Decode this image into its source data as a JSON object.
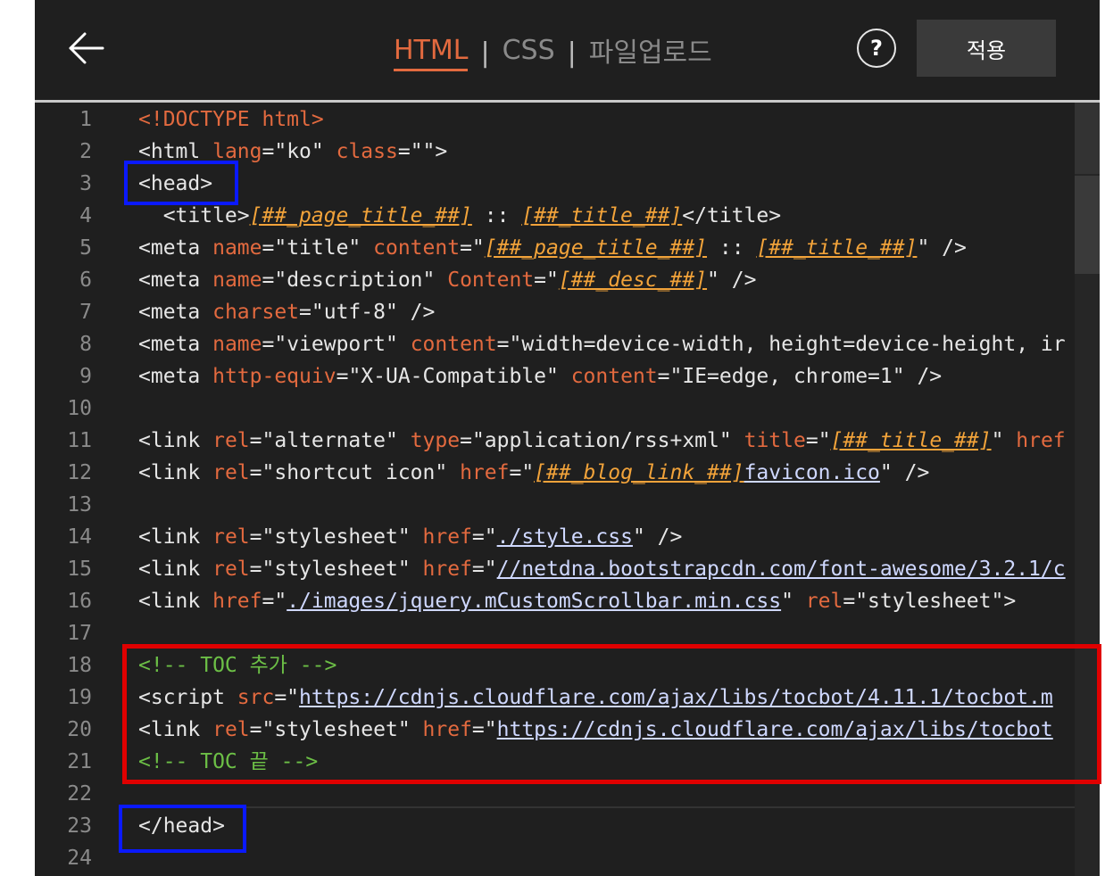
{
  "header": {
    "tabs": [
      {
        "label": "HTML",
        "active": true
      },
      {
        "label": "CSS",
        "active": false
      },
      {
        "label": "파일업로드",
        "active": false
      }
    ],
    "separator": "|",
    "help_label": "?",
    "apply_label": "적용",
    "back_icon": "back-arrow-icon",
    "help_icon": "question-circle-icon"
  },
  "colors": {
    "background": "#1f1f1f",
    "accent": "#e36a3f",
    "template_var": "#f2a33a",
    "comment": "#6cbf46",
    "highlight_blue": "#0a19ff",
    "highlight_red": "#e00000"
  },
  "code": {
    "lines": [
      {
        "n": "1",
        "segs": [
          [
            "dt",
            "<!DOCTYPE html>"
          ]
        ]
      },
      {
        "n": "2",
        "segs": [
          [
            "t",
            "<html "
          ],
          [
            "at",
            "lang"
          ],
          [
            "t",
            "="
          ],
          [
            "s",
            "\"ko\""
          ],
          [
            "t",
            " "
          ],
          [
            "at",
            "class"
          ],
          [
            "t",
            "="
          ],
          [
            "s",
            "\"\""
          ],
          [
            "t",
            ">"
          ]
        ]
      },
      {
        "n": "3",
        "segs": [
          [
            "t",
            "<head>"
          ]
        ]
      },
      {
        "n": "4",
        "segs": [
          [
            "t",
            "  <title>"
          ],
          [
            "tpl",
            "[##_page_title_##]"
          ],
          [
            "t",
            " :: "
          ],
          [
            "tpl",
            "[##_title_##]"
          ],
          [
            "t",
            "</title>"
          ]
        ]
      },
      {
        "n": "5",
        "segs": [
          [
            "t",
            "<meta "
          ],
          [
            "at",
            "name"
          ],
          [
            "t",
            "="
          ],
          [
            "s",
            "\"title\""
          ],
          [
            "t",
            " "
          ],
          [
            "at",
            "content"
          ],
          [
            "t",
            "=\""
          ],
          [
            "tpl",
            "[##_page_title_##]"
          ],
          [
            "t",
            " :: "
          ],
          [
            "tpl",
            "[##_title_##]"
          ],
          [
            "t",
            "\" />"
          ]
        ]
      },
      {
        "n": "6",
        "segs": [
          [
            "t",
            "<meta "
          ],
          [
            "at",
            "name"
          ],
          [
            "t",
            "="
          ],
          [
            "s",
            "\"description\""
          ],
          [
            "t",
            " "
          ],
          [
            "at",
            "Content"
          ],
          [
            "t",
            "=\""
          ],
          [
            "tpl",
            "[##_desc_##]"
          ],
          [
            "t",
            "\" />"
          ]
        ]
      },
      {
        "n": "7",
        "segs": [
          [
            "t",
            "<meta "
          ],
          [
            "at",
            "charset"
          ],
          [
            "t",
            "="
          ],
          [
            "s",
            "\"utf-8\""
          ],
          [
            "t",
            " />"
          ]
        ]
      },
      {
        "n": "8",
        "segs": [
          [
            "t",
            "<meta "
          ],
          [
            "at",
            "name"
          ],
          [
            "t",
            "="
          ],
          [
            "s",
            "\"viewport\""
          ],
          [
            "t",
            " "
          ],
          [
            "at",
            "content"
          ],
          [
            "t",
            "="
          ],
          [
            "s",
            "\"width=device-width, height=device-height, ir"
          ]
        ]
      },
      {
        "n": "9",
        "segs": [
          [
            "t",
            "<meta "
          ],
          [
            "at",
            "http-equiv"
          ],
          [
            "t",
            "="
          ],
          [
            "s",
            "\"X-UA-Compatible\""
          ],
          [
            "t",
            " "
          ],
          [
            "at",
            "content"
          ],
          [
            "t",
            "="
          ],
          [
            "s",
            "\"IE=edge, chrome=1\""
          ],
          [
            "t",
            " />"
          ]
        ]
      },
      {
        "n": "10",
        "segs": []
      },
      {
        "n": "11",
        "segs": [
          [
            "t",
            "<link "
          ],
          [
            "at",
            "rel"
          ],
          [
            "t",
            "="
          ],
          [
            "s",
            "\"alternate\""
          ],
          [
            "t",
            " "
          ],
          [
            "at",
            "type"
          ],
          [
            "t",
            "="
          ],
          [
            "s",
            "\"application/rss+xml\""
          ],
          [
            "t",
            " "
          ],
          [
            "at",
            "title"
          ],
          [
            "t",
            "=\""
          ],
          [
            "tpl",
            "[##_title_##]"
          ],
          [
            "t",
            "\" "
          ],
          [
            "at",
            "href"
          ]
        ]
      },
      {
        "n": "12",
        "segs": [
          [
            "t",
            "<link "
          ],
          [
            "at",
            "rel"
          ],
          [
            "t",
            "="
          ],
          [
            "s",
            "\"shortcut icon\""
          ],
          [
            "t",
            " "
          ],
          [
            "at",
            "href"
          ],
          [
            "t",
            "=\""
          ],
          [
            "tpl",
            "[##_blog_link_##]"
          ],
          [
            "url",
            "favicon.ico"
          ],
          [
            "t",
            "\" />"
          ]
        ]
      },
      {
        "n": "13",
        "segs": []
      },
      {
        "n": "14",
        "segs": [
          [
            "t",
            "<link "
          ],
          [
            "at",
            "rel"
          ],
          [
            "t",
            "="
          ],
          [
            "s",
            "\"stylesheet\""
          ],
          [
            "t",
            " "
          ],
          [
            "at",
            "href"
          ],
          [
            "t",
            "=\""
          ],
          [
            "url",
            "./style.css"
          ],
          [
            "t",
            "\" />"
          ]
        ]
      },
      {
        "n": "15",
        "segs": [
          [
            "t",
            "<link "
          ],
          [
            "at",
            "rel"
          ],
          [
            "t",
            "="
          ],
          [
            "s",
            "\"stylesheet\""
          ],
          [
            "t",
            " "
          ],
          [
            "at",
            "href"
          ],
          [
            "t",
            "=\""
          ],
          [
            "url",
            "//netdna.bootstrapcdn.com/font-awesome/3.2.1/c"
          ]
        ]
      },
      {
        "n": "16",
        "segs": [
          [
            "t",
            "<link "
          ],
          [
            "at",
            "href"
          ],
          [
            "t",
            "=\""
          ],
          [
            "url",
            "./images/jquery.mCustomScrollbar.min.css"
          ],
          [
            "t",
            "\" "
          ],
          [
            "at",
            "rel"
          ],
          [
            "t",
            "="
          ],
          [
            "s",
            "\"stylesheet\""
          ],
          [
            "t",
            ">"
          ]
        ]
      },
      {
        "n": "17",
        "segs": []
      },
      {
        "n": "18",
        "segs": [
          [
            "cm",
            "<!-- TOC 추가 -->"
          ]
        ]
      },
      {
        "n": "19",
        "segs": [
          [
            "t",
            "<script "
          ],
          [
            "at",
            "src"
          ],
          [
            "t",
            "=\""
          ],
          [
            "url",
            "https://cdnjs.cloudflare.com/ajax/libs/tocbot/4.11.1/tocbot.m"
          ]
        ]
      },
      {
        "n": "20",
        "segs": [
          [
            "t",
            "<link "
          ],
          [
            "at",
            "rel"
          ],
          [
            "t",
            "="
          ],
          [
            "s",
            "\"stylesheet\""
          ],
          [
            "t",
            " "
          ],
          [
            "at",
            "href"
          ],
          [
            "t",
            "=\""
          ],
          [
            "url",
            "https://cdnjs.cloudflare.com/ajax/libs/tocbot"
          ]
        ]
      },
      {
        "n": "21",
        "segs": [
          [
            "cm",
            "<!-- TOC 끝 -->"
          ]
        ]
      },
      {
        "n": "22",
        "segs": []
      },
      {
        "n": "23",
        "segs": [
          [
            "t",
            "</head>"
          ]
        ]
      },
      {
        "n": "24",
        "segs": []
      }
    ]
  }
}
